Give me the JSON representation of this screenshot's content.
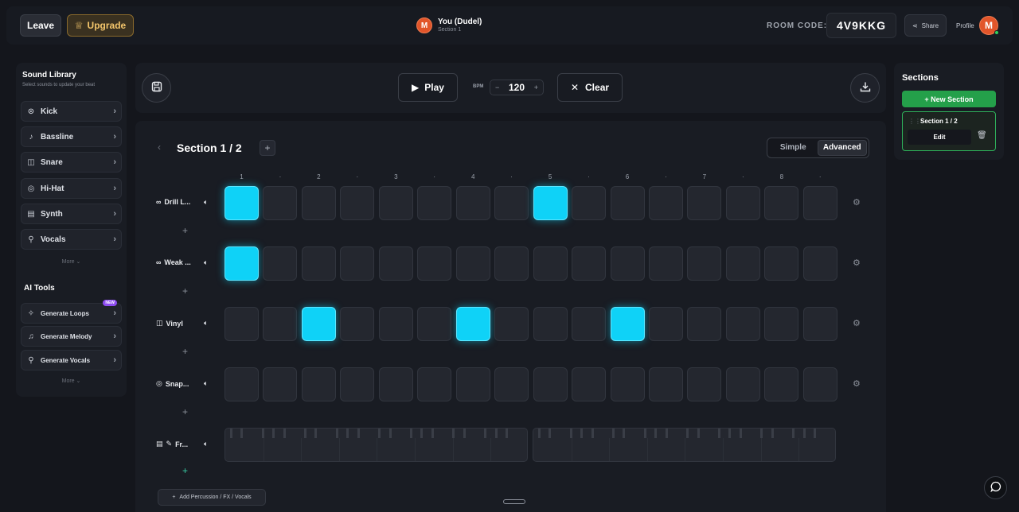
{
  "header": {
    "leave_label": "Leave",
    "upgrade_label": "Upgrade",
    "user": {
      "avatar_letter": "M",
      "name": "You (Dudel)",
      "section": "Section 1"
    },
    "room_code_label": "ROOM CODE:",
    "room_code": "4V9KKG",
    "share_label": "Share",
    "profile_label": "Profile",
    "profile_avatar_letter": "M"
  },
  "sidebar": {
    "title": "Sound Library",
    "subtitle": "Select sounds to update your beat",
    "items": [
      {
        "label": "Kick",
        "icon": "kick-icon"
      },
      {
        "label": "Bassline",
        "icon": "note-icon"
      },
      {
        "label": "Snare",
        "icon": "drum-icon"
      },
      {
        "label": "Hi-Hat",
        "icon": "hihat-icon"
      },
      {
        "label": "Synth",
        "icon": "keyboard-icon"
      },
      {
        "label": "Vocals",
        "icon": "mic-icon"
      }
    ],
    "more_label": "More ⌄",
    "ai_title": "AI Tools",
    "ai_items": [
      {
        "label": "Generate Loops",
        "badge": "NEW"
      },
      {
        "label": "Generate Melody"
      },
      {
        "label": "Generate Vocals"
      }
    ],
    "ai_more_label": "More ⌄"
  },
  "transport": {
    "play_label": "Play",
    "bpm_label": "BPM",
    "bpm_minus": "−",
    "bpm_value": "120",
    "bpm_plus": "+",
    "clear_label": "Clear"
  },
  "sequencer": {
    "section_title": "Section 1 / 2",
    "mode_simple": "Simple",
    "mode_advanced": "Advanced",
    "mode_selected": "Advanced",
    "step_labels": [
      "1",
      "·",
      "2",
      "·",
      "3",
      "·",
      "4",
      "·",
      "5",
      "·",
      "6",
      "·",
      "7",
      "·",
      "8",
      "·"
    ],
    "tracks": [
      {
        "name": "Drill L...",
        "icon": "loop-icon",
        "active_steps": [
          0,
          8
        ]
      },
      {
        "name": "Weak ...",
        "icon": "loop-icon",
        "active_steps": [
          0
        ]
      },
      {
        "name": "Vinyl",
        "icon": "drum-icon",
        "active_steps": [
          2,
          6,
          10
        ]
      },
      {
        "name": "Snap...",
        "icon": "hihat-icon",
        "active_steps": []
      }
    ],
    "piano_track": {
      "name": "Fr...",
      "icon": "keyboard-icon"
    },
    "add_percussion_label": "Add Percussion / FX / Vocals"
  },
  "sections_panel": {
    "title": "Sections",
    "new_section_label": "+ New Section",
    "section_label": "Section 1 / 2",
    "edit_label": "Edit"
  },
  "colors": {
    "active_pad": "#0fd2f7",
    "inactive_pad": "#24272f",
    "new_section_green": "#24a04a",
    "upgrade_gold": "#f3c56b"
  }
}
